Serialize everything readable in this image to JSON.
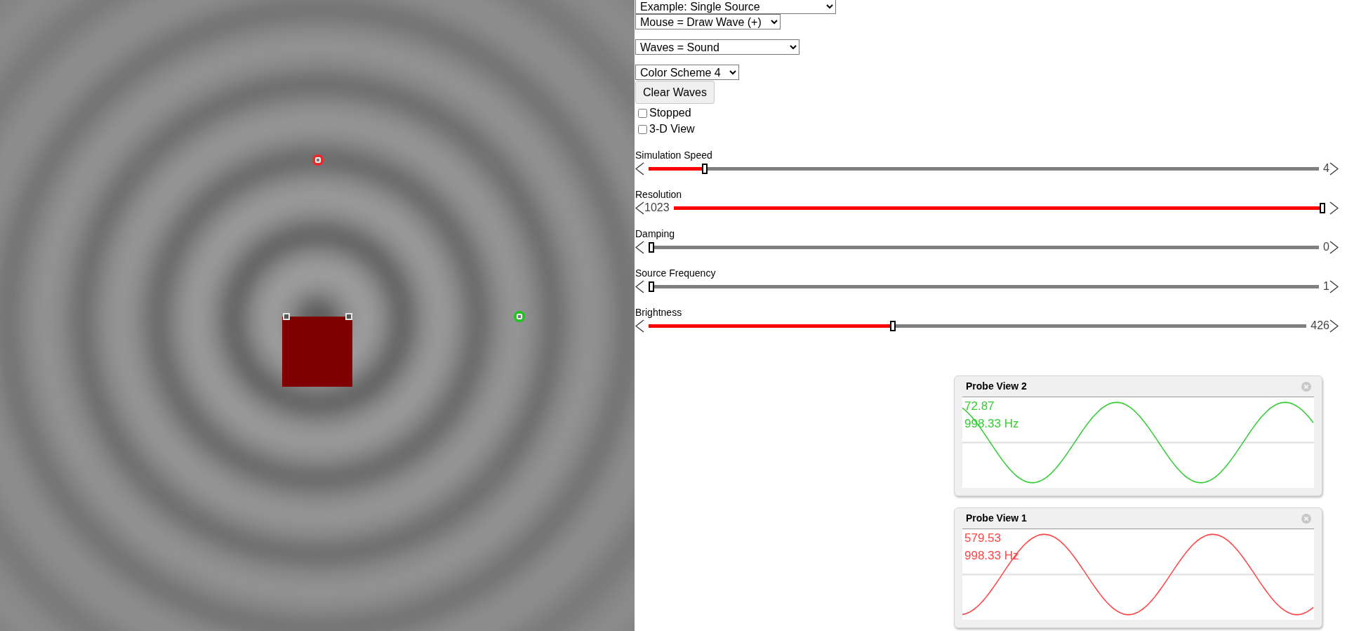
{
  "selects": [
    {
      "value": "Example: Single Source"
    },
    {
      "value": "Mouse = Draw Wave (+)"
    },
    {
      "value": "Waves = Sound"
    },
    {
      "value": "Color Scheme 4"
    }
  ],
  "clear_button": "Clear Waves",
  "checkboxes": [
    {
      "label": "Stopped",
      "checked": false
    },
    {
      "label": "3-D View",
      "checked": false
    }
  ],
  "sliders": [
    {
      "label": "Simulation Speed",
      "value": "4",
      "kind": "readout-right",
      "level": 0.08
    },
    {
      "label": "Resolution",
      "value": "1023",
      "kind": "readout-left",
      "level": 1
    },
    {
      "label": "Damping",
      "value": "0",
      "kind": "readout-right",
      "level": 0
    },
    {
      "label": "Source Frequency",
      "value": "1",
      "kind": "readout-right",
      "level": 0
    },
    {
      "label": "Brightness",
      "value": "426",
      "kind": "readout-right",
      "level": 0.37
    }
  ],
  "probe_views": [
    {
      "title": "Probe View 2",
      "reading": "72.87",
      "frequency": "998.33 Hz",
      "color": "#33cc33"
    },
    {
      "title": "Probe View 1",
      "reading": "579.53",
      "frequency": "998.33 Hz",
      "color": "#ff4444"
    }
  ]
}
